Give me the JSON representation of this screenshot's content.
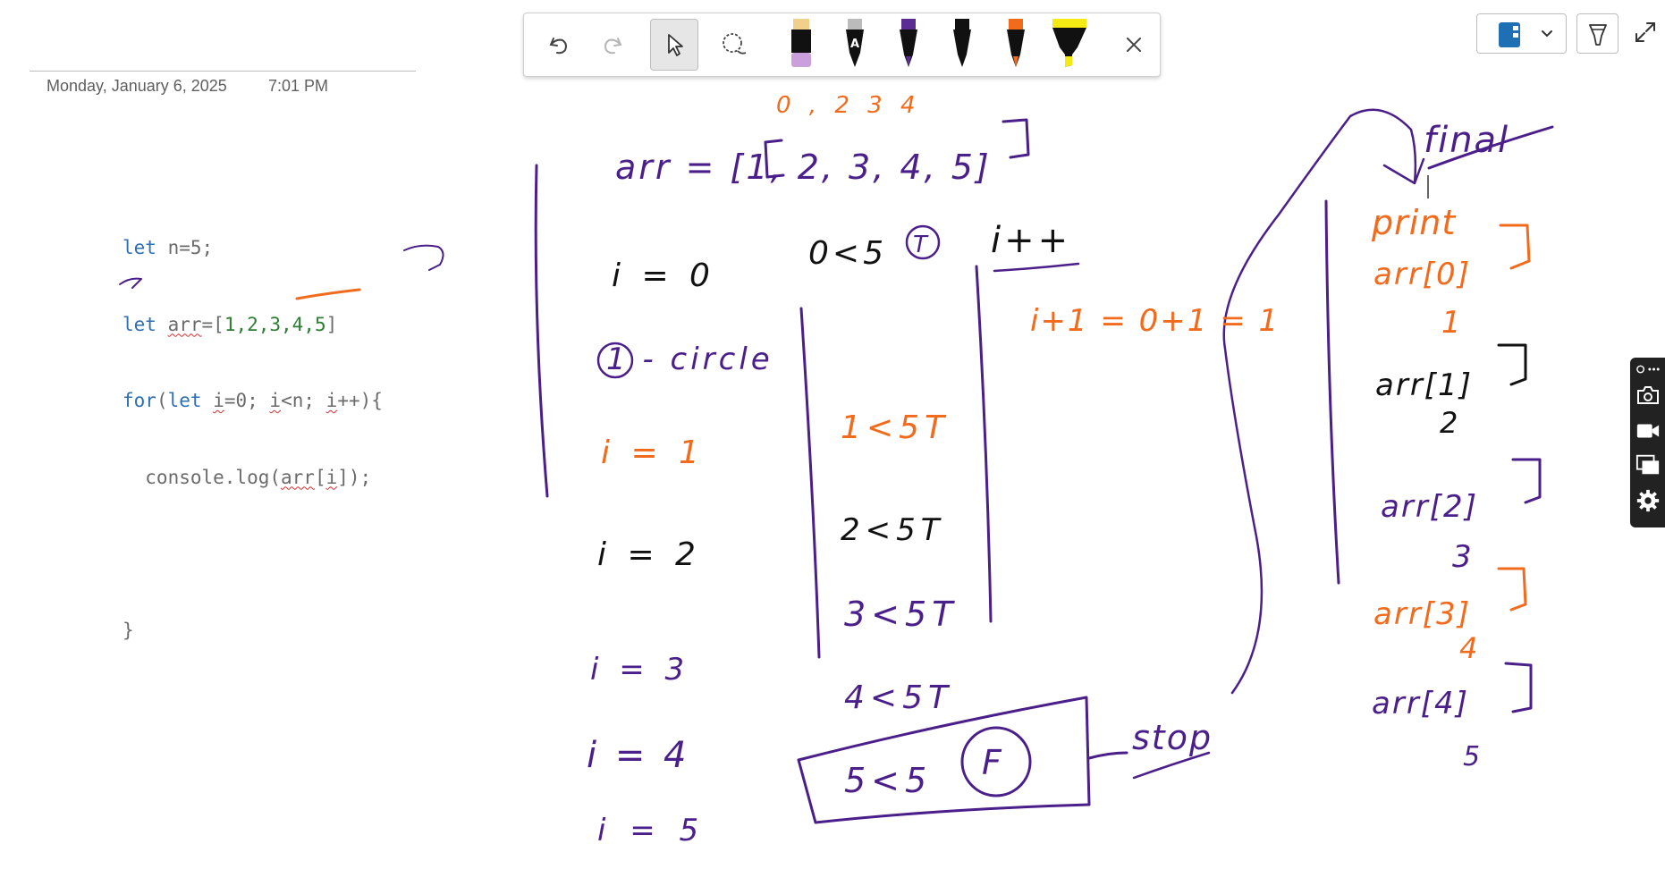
{
  "page": {
    "date": "Monday, January 6, 2025",
    "time": "7:01 PM"
  },
  "code": {
    "line1": {
      "kw": "let",
      "rest": " n=5;"
    },
    "line2": {
      "kw": "let",
      "sp": " ",
      "var": "arr",
      "eq": "=[",
      "nums": "1,2,3,4,5",
      "end": "]"
    },
    "line3": {
      "kw1": "for",
      "p1": "(",
      "kw2": "let",
      "sp": " ",
      "i1": "i",
      "a": "=0; ",
      "i2": "i",
      "b": "<n; ",
      "i3": "i",
      "c": "++){"
    },
    "line4": {
      "indent": "  console.log(",
      "arr": "arr",
      "br1": "[",
      "i": "i",
      "br2": "]);"
    },
    "line5": "}"
  },
  "toolbar": {
    "undo": "undo-icon",
    "redo": "redo-icon",
    "select": "pointer-icon",
    "lasso": "lasso-icon",
    "close": "close-icon"
  },
  "pens": [
    {
      "name": "pen-purple-black",
      "color": "#c9a0dc"
    },
    {
      "name": "pen-white-a",
      "color": "#000000"
    },
    {
      "name": "pen-purple",
      "color": "#5b2c91"
    },
    {
      "name": "pen-black",
      "color": "#000000"
    },
    {
      "name": "pen-orange",
      "color": "#f26b1d"
    },
    {
      "name": "highlighter-yellow",
      "color": "#f5ea14"
    }
  ],
  "colors": {
    "ink_purple": "#4b1f8a",
    "ink_orange": "#f26b1d",
    "ink_black": "#111111",
    "accent_blue": "#1f6fb5"
  },
  "ink": {
    "indices": "0 , 2 3 4",
    "arr_decl": "arr = [1, 2, 3, 4, 5]",
    "i0": "i = 0",
    "cond0": "0<5",
    "T0": "T",
    "inc": "i++",
    "circle_label": "1 - circle",
    "i_plus": "i+1 = 0+1 = 1",
    "i1": "i = 1",
    "c1": "1<5T",
    "i2": "i = 2",
    "c2": "2<5T",
    "c3": "3<5T",
    "i3": "i = 3",
    "c4": "4<5T",
    "i4": "i = 4",
    "c5": "5<5",
    "F": "F",
    "i5": "i = 5",
    "stop": "stop",
    "final": "final",
    "print": "print",
    "a0": "arr[0]",
    "v1": "1",
    "a1": "arr[1]",
    "v2": "2",
    "a2": "arr[2]",
    "v3": "3",
    "a3": "arr[3]",
    "v4": "4",
    "a4": "arr[4]",
    "v5": "5"
  }
}
